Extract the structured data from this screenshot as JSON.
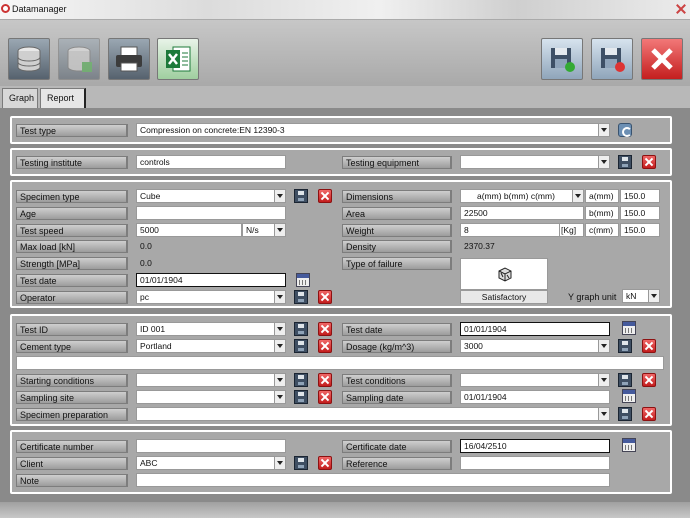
{
  "window": {
    "title": "Datamanager"
  },
  "tabs": [
    {
      "label": "Graph"
    },
    {
      "label": "Report"
    }
  ],
  "toolbar": {
    "icons": [
      "database-icon",
      "database-add-icon",
      "printer-icon",
      "excel-icon",
      "save-disk-icon",
      "save-disk-red-icon",
      "close-red-icon"
    ]
  },
  "sec1": {
    "test_type_label": "Test type",
    "test_type_value": "Compression on concrete:EN 12390-3"
  },
  "sec2": {
    "testing_institute_label": "Testing institute",
    "testing_institute_value": "controls",
    "testing_equipment_label": "Testing equipment",
    "testing_equipment_value": ""
  },
  "sec3": {
    "specimen_type_label": "Specimen type",
    "specimen_type_value": "Cube",
    "age_label": "Age",
    "age_value": "",
    "test_speed_label": "Test speed",
    "test_speed_value": "5000",
    "test_speed_unit": "N/s",
    "max_load_label": "Max load [kN]",
    "max_load_value": "0.0",
    "strength_label": "Strength [MPa]",
    "strength_value": "0.0",
    "test_date_label": "Test date",
    "test_date_value": "01/01/1904",
    "operator_label": "Operator",
    "operator_value": "pc",
    "dimensions_label": "Dimensions",
    "dimensions_value": "a(mm) b(mm) c(mm)",
    "dim_a_label": "a(mm)",
    "dim_a_value": "150.0",
    "dim_b_label": "b(mm)",
    "dim_b_value": "150.0",
    "dim_c_label": "c(mm)",
    "dim_c_value": "150.0",
    "area_label": "Area",
    "area_value": "22500",
    "weight_label": "Weight",
    "weight_value": "8",
    "weight_unit": "[Kg]",
    "density_label": "Density",
    "density_value": "2370.37",
    "failure_label": "Type of failure",
    "failure_value": "Satisfactory",
    "y_graph_unit_label": "Y graph unit",
    "y_graph_unit_value": "kN"
  },
  "sec4": {
    "test_id_label": "Test ID",
    "test_id_value": "ID 001",
    "test_date_label": "Test date",
    "test_date_value": "01/01/1904",
    "cement_type_label": "Cement type",
    "cement_type_value": "Portland",
    "dosage_label": "Dosage (kg/m^3)",
    "dosage_value": "3000",
    "notes_value": "",
    "starting_conditions_label": "Starting conditions",
    "starting_conditions_value": "",
    "test_conditions_label": "Test conditions",
    "test_conditions_value": "",
    "sampling_site_label": "Sampling site",
    "sampling_site_value": "",
    "sampling_date_label": "Sampling date",
    "sampling_date_value": "01/01/1904",
    "specimen_preparation_label": "Specimen preparation",
    "specimen_preparation_value": ""
  },
  "sec5": {
    "certificate_number_label": "Certificate number",
    "certificate_number_value": "",
    "certificate_date_label": "Certificate date",
    "certificate_date_value": "16/04/2510",
    "client_label": "Client",
    "client_value": "ABC",
    "reference_label": "Reference",
    "reference_value": "",
    "note_label": "Note",
    "note_value": ""
  }
}
